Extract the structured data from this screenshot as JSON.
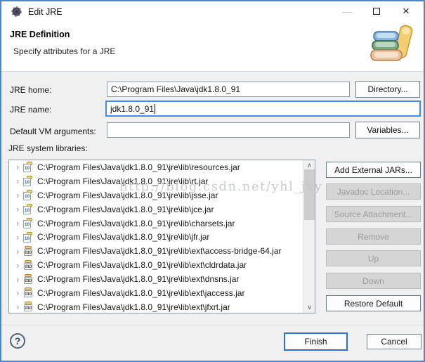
{
  "window": {
    "title": "Edit JRE"
  },
  "header": {
    "title": "JRE Definition",
    "subtitle": "Specify attributes for a JRE"
  },
  "form": {
    "jre_home": {
      "label": "JRE home:",
      "value": "C:\\Program Files\\Java\\jdk1.8.0_91",
      "button": "Directory..."
    },
    "jre_name": {
      "label": "JRE name:",
      "value": "jdk1.8.0_91"
    },
    "vm_args": {
      "label": "Default VM arguments:",
      "value": "",
      "button": "Variables..."
    },
    "libraries_label": "JRE system libraries:"
  },
  "library_list": {
    "items": [
      {
        "path": "C:\\Program Files\\Java\\jdk1.8.0_91\\jre\\lib\\resources.jar",
        "icon": "jar-src"
      },
      {
        "path": "C:\\Program Files\\Java\\jdk1.8.0_91\\jre\\lib\\rt.jar",
        "icon": "jar-src"
      },
      {
        "path": "C:\\Program Files\\Java\\jdk1.8.0_91\\jre\\lib\\jsse.jar",
        "icon": "jar-src"
      },
      {
        "path": "C:\\Program Files\\Java\\jdk1.8.0_91\\jre\\lib\\jce.jar",
        "icon": "jar-src"
      },
      {
        "path": "C:\\Program Files\\Java\\jdk1.8.0_91\\jre\\lib\\charsets.jar",
        "icon": "jar-src"
      },
      {
        "path": "C:\\Program Files\\Java\\jdk1.8.0_91\\jre\\lib\\jfr.jar",
        "icon": "jar-src"
      },
      {
        "path": "C:\\Program Files\\Java\\jdk1.8.0_91\\jre\\lib\\ext\\access-bridge-64.jar",
        "icon": "jar-bin"
      },
      {
        "path": "C:\\Program Files\\Java\\jdk1.8.0_91\\jre\\lib\\ext\\cldrdata.jar",
        "icon": "jar-bin"
      },
      {
        "path": "C:\\Program Files\\Java\\jdk1.8.0_91\\jre\\lib\\ext\\dnsns.jar",
        "icon": "jar-bin"
      },
      {
        "path": "C:\\Program Files\\Java\\jdk1.8.0_91\\jre\\lib\\ext\\jaccess.jar",
        "icon": "jar-bin"
      },
      {
        "path": "C:\\Program Files\\Java\\jdk1.8.0_91\\jre\\lib\\ext\\jfxrt.jar",
        "icon": "jar-bin"
      }
    ]
  },
  "side_buttons": [
    {
      "label": "Add External JARs...",
      "enabled": true
    },
    {
      "label": "Javadoc Location...",
      "enabled": false
    },
    {
      "label": "Source Attachment...",
      "enabled": false
    },
    {
      "label": "Remove",
      "enabled": false
    },
    {
      "label": "Up",
      "enabled": false
    },
    {
      "label": "Down",
      "enabled": false
    },
    {
      "label": "Restore Default",
      "enabled": true
    }
  ],
  "footer": {
    "help": "?",
    "finish": "Finish",
    "cancel": "Cancel"
  },
  "watermark": "http://blog.csdn.net/yhl_jxy",
  "icons": {
    "chevron": "›",
    "jar_src_glyph": "10",
    "jar_bin_glyph": "010",
    "scroll_up": "∧",
    "scroll_down": "∨",
    "minimize": "—",
    "close": "×"
  },
  "colors": {
    "accent_border": "#4c86c6",
    "focus_field": "#3f8fe5",
    "default_button": "#2f74c5",
    "disabled_bg": "#d5d5d5",
    "body_bg": "#f0f0f0"
  }
}
